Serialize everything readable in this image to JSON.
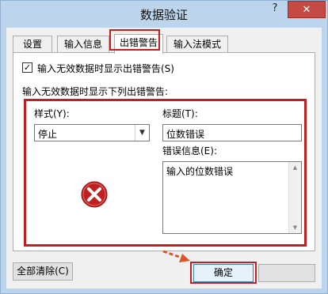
{
  "window": {
    "title": "数据验证",
    "help_label": "?",
    "close_label": "✕"
  },
  "tabs": [
    {
      "label": "设置",
      "active": false
    },
    {
      "label": "输入信息",
      "active": false
    },
    {
      "label": "出错警告",
      "active": true
    },
    {
      "label": "输入法模式",
      "active": false
    }
  ],
  "error_alert": {
    "show_checkbox_checked": true,
    "show_checkbox_label": "输入无效数据时显示出错警告(S)",
    "group_label": "输入无效数据时显示下列出错警告:",
    "style_label": "样式(Y):",
    "style_value": "停止",
    "title_label": "标题(T):",
    "title_value": "位数错误",
    "message_label": "错误信息(E):",
    "message_value": "输入的位数错误",
    "icon": "error-stop-icon"
  },
  "footer": {
    "clear_all_label": "全部清除(C)",
    "ok_label": "确定",
    "cancel_label": ""
  },
  "colors": {
    "highlight": "#c0201f",
    "arrow": "#d9562a",
    "error_icon": "#c0201f"
  }
}
